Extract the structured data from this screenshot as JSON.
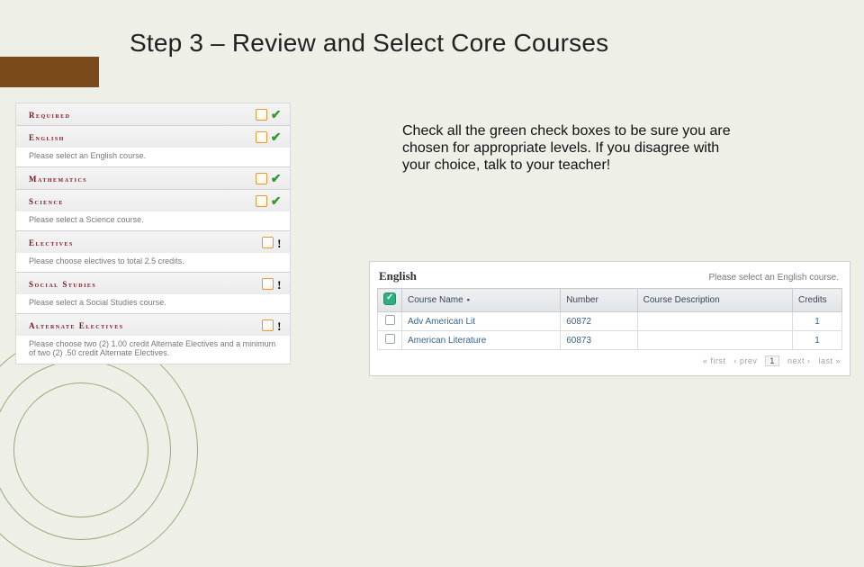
{
  "title": "Step 3 – Review and Select Core Courses",
  "instruction": "Check all the green check boxes to be sure you are chosen for appropriate levels. If you disagree with your choice, talk to your teacher!",
  "sections": [
    {
      "label": "Required",
      "sub": "",
      "status": "ok"
    },
    {
      "label": "English",
      "sub": "Please select an English course.",
      "status": "ok"
    },
    {
      "label": "Mathematics",
      "sub": "",
      "status": "ok"
    },
    {
      "label": "Science",
      "sub": "Please select a Science course.",
      "status": "ok"
    },
    {
      "label": "Electives",
      "sub": "Please choose electives to total 2.5 credits.",
      "status": "warn"
    },
    {
      "label": "Social Studies",
      "sub": "Please select a Social Studies course.",
      "status": "warn"
    },
    {
      "label": "Alternate Electives",
      "sub": "Please choose two (2) 1.00 credit Alternate Electives and a minimum of two (2) .50 credit Alternate Electives.",
      "status": "warn"
    }
  ],
  "coursePanel": {
    "heading": "English",
    "hint": "Please select an English course.",
    "columns": [
      "Course Name",
      "Number",
      "Course Description",
      "Credits"
    ],
    "rows": [
      {
        "name": "Adv American Lit",
        "number": "60872",
        "desc": "",
        "credits": "1"
      },
      {
        "name": "American Literature",
        "number": "60873",
        "desc": "",
        "credits": "1"
      }
    ],
    "pager": {
      "first": "« first",
      "prev": "‹ prev",
      "current": "1",
      "next": "next ›",
      "last": "last »"
    }
  }
}
